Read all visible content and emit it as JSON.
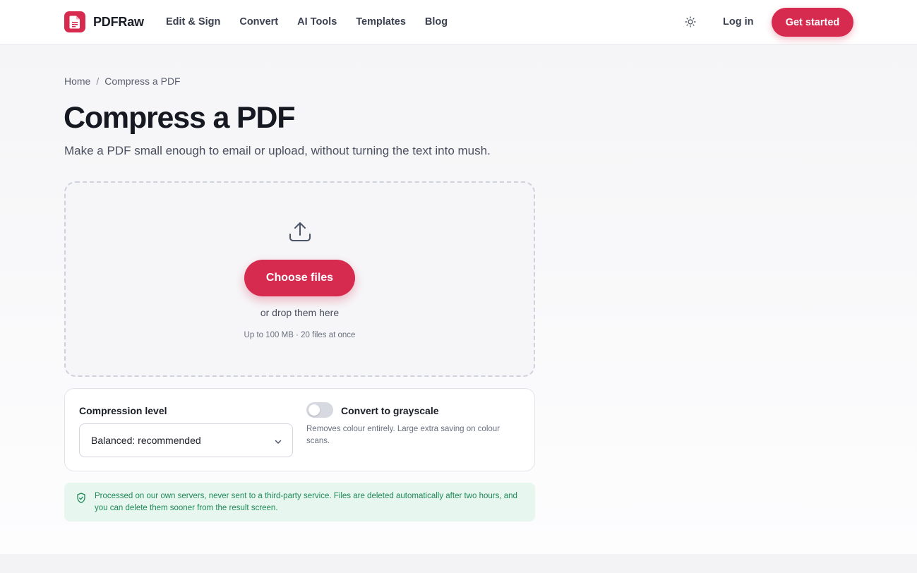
{
  "header": {
    "logo_text": "PDFRaw",
    "nav": [
      "Edit & Sign",
      "Convert",
      "AI Tools",
      "Templates",
      "Blog"
    ],
    "theme_icon": "sun-icon",
    "login_label": "Log in",
    "cta_label": "Get started"
  },
  "breadcrumb": {
    "home": "Home",
    "separator": "/",
    "current": "Compress a PDF"
  },
  "page": {
    "title": "Compress a PDF",
    "subtitle": "Make a PDF small enough to email or upload, without turning the text into mush."
  },
  "dropzone": {
    "icon": "upload-icon",
    "button_label": "Choose files",
    "drop_text": "or drop them here",
    "limits": "Up to 100 MB · 20 files at once"
  },
  "options": {
    "compression_label": "Compression level",
    "compression_value": "Balanced: recommended",
    "grayscale_label": "Convert to grayscale",
    "grayscale_enabled": false,
    "grayscale_description": "Removes colour entirely. Large extra saving on colour scans."
  },
  "privacy": {
    "icon": "shield-check-icon",
    "text": "Processed on our own servers, never sent to a third-party service. Files are deleted automatically after two hours, and you can delete them sooner from the result screen."
  },
  "colors": {
    "accent": "#d62a4f",
    "privacy_bg": "#e7f6ee",
    "privacy_text": "#1f8a57"
  }
}
